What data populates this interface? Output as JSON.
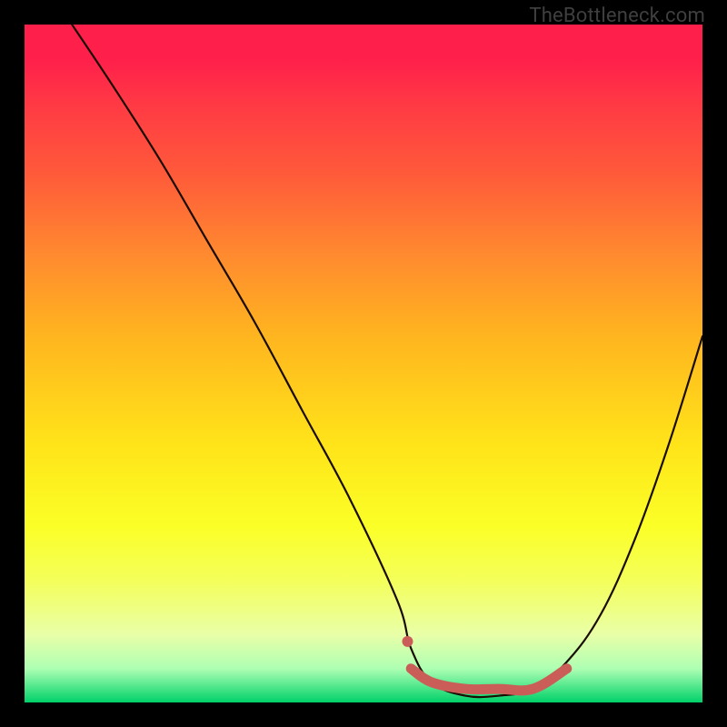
{
  "watermark": "TheBottleneck.com",
  "chart_data": {
    "type": "line",
    "title": "",
    "xlabel": "",
    "ylabel": "",
    "xlim": [
      0,
      100
    ],
    "ylim": [
      0,
      100
    ],
    "background_gradient": {
      "top": "#ff1f4b",
      "middle": "#ffe419",
      "bottom": "#00d169"
    },
    "series": [
      {
        "name": "curve",
        "color": "#1a0d03",
        "x": [
          7,
          13,
          20,
          27,
          34,
          41,
          48,
          55,
          57,
          60,
          65,
          70,
          75,
          80,
          85,
          90,
          95,
          100
        ],
        "values": [
          100,
          91,
          80,
          68,
          56,
          43,
          30,
          15,
          8,
          3,
          1,
          1,
          2,
          6,
          13,
          24,
          38,
          54
        ]
      }
    ],
    "highlight_segment": {
      "color": "#cb5d59",
      "start_dot": {
        "x": 56.5,
        "y": 9
      },
      "x": [
        57,
        60,
        65,
        70,
        75,
        80
      ],
      "values": [
        5,
        3,
        2,
        2,
        2,
        5
      ]
    },
    "annotations": []
  }
}
